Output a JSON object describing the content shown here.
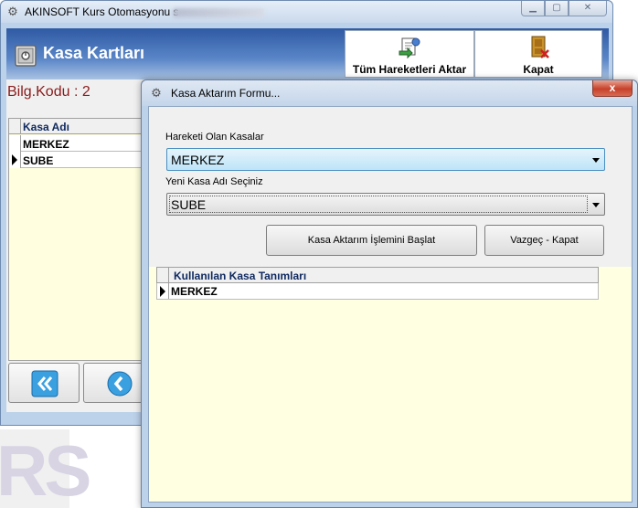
{
  "main_window": {
    "title": "AKINSOFT Kurs Otomasyonu s",
    "header_title": "Kasa Kartları",
    "toolbar": {
      "transfer_all_label": "Tüm Hareketleri Aktar",
      "close_label": "Kapat"
    },
    "bilg_kodu": "Bilg.Kodu : 2",
    "grid": {
      "column": "Kasa Adı",
      "rows": [
        "MERKEZ",
        "SUBE"
      ]
    }
  },
  "background_mark": "RS",
  "dialog": {
    "title": "Kasa Aktarım Formu...",
    "close_glyph": "x",
    "source_label": "Hareketi Olan Kasalar",
    "source_value": "MERKEZ",
    "target_label": "Yeni Kasa Adı Seçiniz",
    "target_value": "SUBE",
    "start_button": "Kasa Aktarım İşlemini Başlat",
    "cancel_button": "Vazgeç - Kapat",
    "grid": {
      "column": "Kullanılan Kasa Tanımları",
      "rows": [
        "MERKEZ"
      ]
    }
  },
  "icons": {
    "app": "gear-icon",
    "header": "safe-icon",
    "transfer": "transfer-icon",
    "close": "door-exit-icon",
    "nav_first": "double-chevron-left-icon",
    "nav_prev": "chevron-left-icon"
  },
  "colors": {
    "header_band": "#3a66b0",
    "grid_background": "#ffffdf",
    "bilg_text": "#8b1a1a",
    "dialog_close": "#c7412a"
  }
}
